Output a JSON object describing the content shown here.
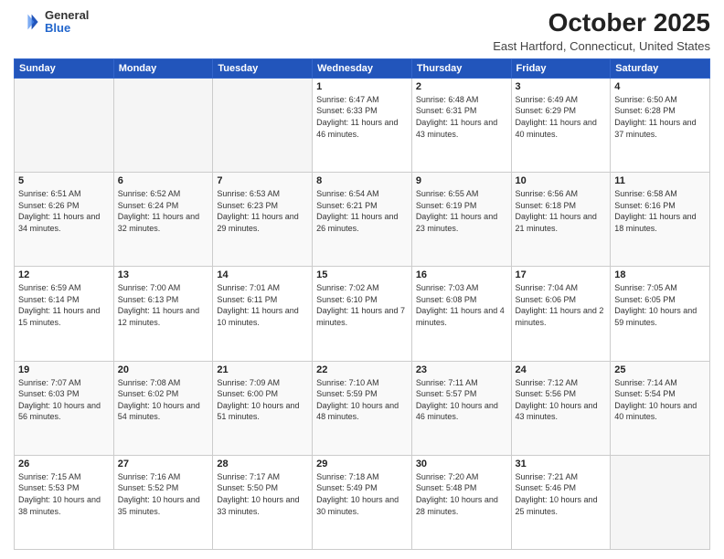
{
  "logo": {
    "general": "General",
    "blue": "Blue"
  },
  "header": {
    "month": "October 2025",
    "location": "East Hartford, Connecticut, United States"
  },
  "weekdays": [
    "Sunday",
    "Monday",
    "Tuesday",
    "Wednesday",
    "Thursday",
    "Friday",
    "Saturday"
  ],
  "weeks": [
    [
      {
        "day": "",
        "info": ""
      },
      {
        "day": "",
        "info": ""
      },
      {
        "day": "",
        "info": ""
      },
      {
        "day": "1",
        "info": "Sunrise: 6:47 AM\nSunset: 6:33 PM\nDaylight: 11 hours and 46 minutes."
      },
      {
        "day": "2",
        "info": "Sunrise: 6:48 AM\nSunset: 6:31 PM\nDaylight: 11 hours and 43 minutes."
      },
      {
        "day": "3",
        "info": "Sunrise: 6:49 AM\nSunset: 6:29 PM\nDaylight: 11 hours and 40 minutes."
      },
      {
        "day": "4",
        "info": "Sunrise: 6:50 AM\nSunset: 6:28 PM\nDaylight: 11 hours and 37 minutes."
      }
    ],
    [
      {
        "day": "5",
        "info": "Sunrise: 6:51 AM\nSunset: 6:26 PM\nDaylight: 11 hours and 34 minutes."
      },
      {
        "day": "6",
        "info": "Sunrise: 6:52 AM\nSunset: 6:24 PM\nDaylight: 11 hours and 32 minutes."
      },
      {
        "day": "7",
        "info": "Sunrise: 6:53 AM\nSunset: 6:23 PM\nDaylight: 11 hours and 29 minutes."
      },
      {
        "day": "8",
        "info": "Sunrise: 6:54 AM\nSunset: 6:21 PM\nDaylight: 11 hours and 26 minutes."
      },
      {
        "day": "9",
        "info": "Sunrise: 6:55 AM\nSunset: 6:19 PM\nDaylight: 11 hours and 23 minutes."
      },
      {
        "day": "10",
        "info": "Sunrise: 6:56 AM\nSunset: 6:18 PM\nDaylight: 11 hours and 21 minutes."
      },
      {
        "day": "11",
        "info": "Sunrise: 6:58 AM\nSunset: 6:16 PM\nDaylight: 11 hours and 18 minutes."
      }
    ],
    [
      {
        "day": "12",
        "info": "Sunrise: 6:59 AM\nSunset: 6:14 PM\nDaylight: 11 hours and 15 minutes."
      },
      {
        "day": "13",
        "info": "Sunrise: 7:00 AM\nSunset: 6:13 PM\nDaylight: 11 hours and 12 minutes."
      },
      {
        "day": "14",
        "info": "Sunrise: 7:01 AM\nSunset: 6:11 PM\nDaylight: 11 hours and 10 minutes."
      },
      {
        "day": "15",
        "info": "Sunrise: 7:02 AM\nSunset: 6:10 PM\nDaylight: 11 hours and 7 minutes."
      },
      {
        "day": "16",
        "info": "Sunrise: 7:03 AM\nSunset: 6:08 PM\nDaylight: 11 hours and 4 minutes."
      },
      {
        "day": "17",
        "info": "Sunrise: 7:04 AM\nSunset: 6:06 PM\nDaylight: 11 hours and 2 minutes."
      },
      {
        "day": "18",
        "info": "Sunrise: 7:05 AM\nSunset: 6:05 PM\nDaylight: 10 hours and 59 minutes."
      }
    ],
    [
      {
        "day": "19",
        "info": "Sunrise: 7:07 AM\nSunset: 6:03 PM\nDaylight: 10 hours and 56 minutes."
      },
      {
        "day": "20",
        "info": "Sunrise: 7:08 AM\nSunset: 6:02 PM\nDaylight: 10 hours and 54 minutes."
      },
      {
        "day": "21",
        "info": "Sunrise: 7:09 AM\nSunset: 6:00 PM\nDaylight: 10 hours and 51 minutes."
      },
      {
        "day": "22",
        "info": "Sunrise: 7:10 AM\nSunset: 5:59 PM\nDaylight: 10 hours and 48 minutes."
      },
      {
        "day": "23",
        "info": "Sunrise: 7:11 AM\nSunset: 5:57 PM\nDaylight: 10 hours and 46 minutes."
      },
      {
        "day": "24",
        "info": "Sunrise: 7:12 AM\nSunset: 5:56 PM\nDaylight: 10 hours and 43 minutes."
      },
      {
        "day": "25",
        "info": "Sunrise: 7:14 AM\nSunset: 5:54 PM\nDaylight: 10 hours and 40 minutes."
      }
    ],
    [
      {
        "day": "26",
        "info": "Sunrise: 7:15 AM\nSunset: 5:53 PM\nDaylight: 10 hours and 38 minutes."
      },
      {
        "day": "27",
        "info": "Sunrise: 7:16 AM\nSunset: 5:52 PM\nDaylight: 10 hours and 35 minutes."
      },
      {
        "day": "28",
        "info": "Sunrise: 7:17 AM\nSunset: 5:50 PM\nDaylight: 10 hours and 33 minutes."
      },
      {
        "day": "29",
        "info": "Sunrise: 7:18 AM\nSunset: 5:49 PM\nDaylight: 10 hours and 30 minutes."
      },
      {
        "day": "30",
        "info": "Sunrise: 7:20 AM\nSunset: 5:48 PM\nDaylight: 10 hours and 28 minutes."
      },
      {
        "day": "31",
        "info": "Sunrise: 7:21 AM\nSunset: 5:46 PM\nDaylight: 10 hours and 25 minutes."
      },
      {
        "day": "",
        "info": ""
      }
    ]
  ]
}
